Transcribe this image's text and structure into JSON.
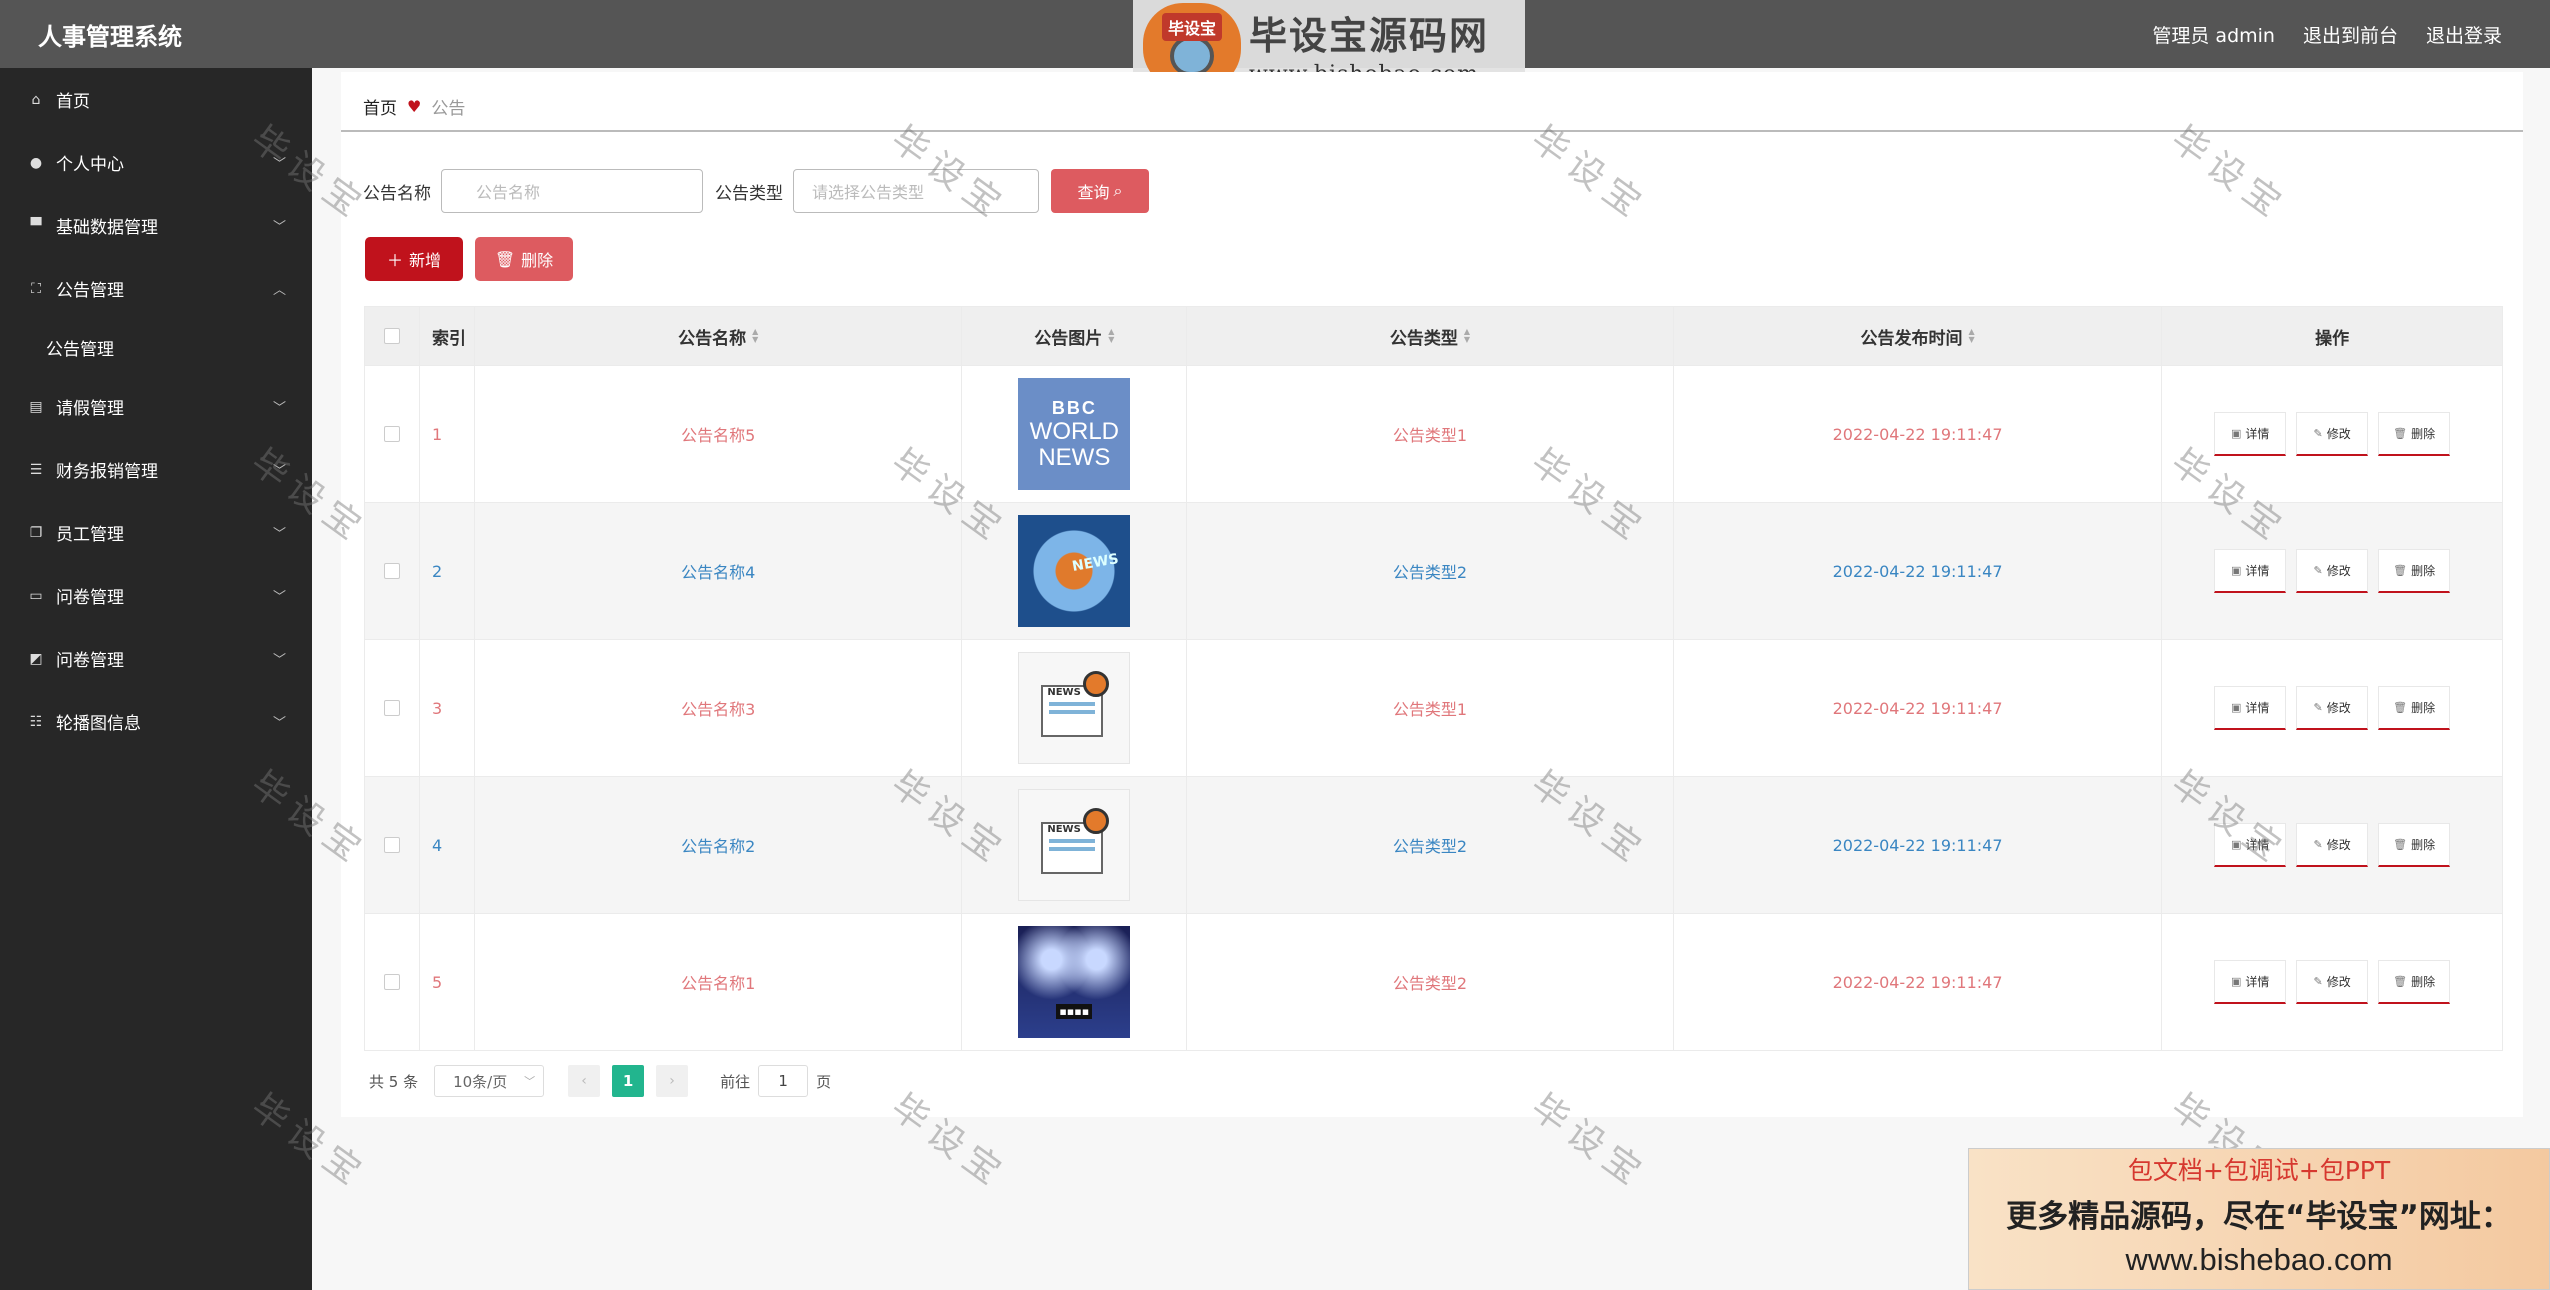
{
  "header": {
    "app_title": "人事管理系统",
    "user_label": "管理员 admin",
    "to_front_label": "退出到前台",
    "logout_label": "退出登录"
  },
  "brand": {
    "logo_text": "毕设宝",
    "name": "毕设宝源码网",
    "url": "www.bishebao.com"
  },
  "sidebar": {
    "items": [
      {
        "label": "首页",
        "icon": "home-icon"
      },
      {
        "label": "个人中心",
        "icon": "user-icon"
      },
      {
        "label": "基础数据管理",
        "icon": "database-icon"
      },
      {
        "label": "公告管理",
        "icon": "notice-icon",
        "expanded": true
      },
      {
        "label": "请假管理",
        "icon": "clipboard-icon"
      },
      {
        "label": "财务报销管理",
        "icon": "list-icon"
      },
      {
        "label": "员工管理",
        "icon": "copy-icon"
      },
      {
        "label": "问卷管理",
        "icon": "survey-icon"
      },
      {
        "label": "问卷管理",
        "icon": "chart-icon"
      },
      {
        "label": "轮播图信息",
        "icon": "sliders-icon"
      }
    ],
    "sub_items": [
      {
        "label": "公告管理"
      }
    ]
  },
  "breadcrumb": {
    "home": "首页",
    "current": "公告"
  },
  "search": {
    "name_label": "公告名称",
    "name_placeholder": "公告名称",
    "type_label": "公告类型",
    "type_placeholder": "请选择公告类型",
    "query_button": "查询"
  },
  "actions": {
    "add": "新增",
    "delete": "删除"
  },
  "table": {
    "columns": [
      "索引",
      "公告名称",
      "公告图片",
      "公告类型",
      "公告发布时间",
      "操作"
    ],
    "rows": [
      {
        "index": "1",
        "name": "公告名称5",
        "type": "公告类型1",
        "time": "2022-04-22 19:11:47",
        "image": "bbc-world-news"
      },
      {
        "index": "2",
        "name": "公告名称4",
        "type": "公告类型2",
        "time": "2022-04-22 19:11:47",
        "image": "globe-news"
      },
      {
        "index": "3",
        "name": "公告名称3",
        "type": "公告类型1",
        "time": "2022-04-22 19:11:47",
        "image": "newspaper-magnifier"
      },
      {
        "index": "4",
        "name": "公告名称2",
        "type": "公告类型2",
        "time": "2022-04-22 19:11:47",
        "image": "newspaper-magnifier"
      },
      {
        "index": "5",
        "name": "公告名称1",
        "type": "公告类型2",
        "time": "2022-04-22 19:11:47",
        "image": "stage-spotlight"
      }
    ],
    "thumb_text": {
      "bbc_top": "BBC",
      "bbc_line1": "WORLD",
      "bbc_line2": "NEWS",
      "globe_text": "NEWS",
      "paper_text": "NEWS"
    },
    "op_labels": {
      "detail": "详情",
      "edit": "修改",
      "delete": "删除"
    }
  },
  "pagination": {
    "total": "共 5 条",
    "page_size": "10条/页",
    "current_page": "1",
    "goto_label": "前往",
    "goto_value": "1",
    "page_suffix": "页"
  },
  "watermark": {
    "text": "毕设宝"
  },
  "promo": {
    "line1": "包文档+包调试+包PPT",
    "line2": "更多精品源码，尽在“毕设宝”网址：",
    "line3": "www.bishebao.com"
  },
  "colors": {
    "header_bg": "#555555",
    "sidebar_bg": "#272727",
    "primary_red": "#c0121c",
    "light_red": "#dd5b60",
    "link_red": "#e0777b",
    "link_blue": "#3a86c2",
    "page_active": "#22b58e"
  }
}
